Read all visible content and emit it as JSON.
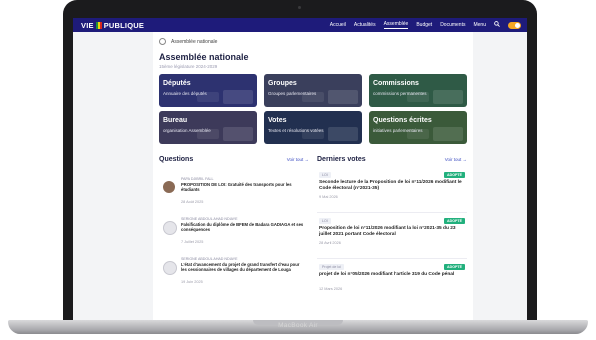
{
  "nav": {
    "logo_left": "VIE",
    "logo_right": "PUBLIQUE",
    "flag_colors": [
      "#1f8f3a",
      "#f2d10a",
      "#d7261e"
    ],
    "links": [
      "Accueil",
      "Actualités",
      "Assemblée",
      "Budget",
      "Documents",
      "Menu"
    ],
    "active": "Assemblée",
    "search_icon": "search-icon",
    "theme_toggle_color": "#f5a623"
  },
  "breadcrumb": {
    "current": "Assemblée nationale"
  },
  "page": {
    "title": "Assemblée nationale",
    "subtitle": "15ème législature 2024-2029"
  },
  "tiles": [
    {
      "title": "Députés",
      "desc": "Annuaire des députés",
      "color": "#2d3270"
    },
    {
      "title": "Groupes",
      "desc": "Groupes parlementaires",
      "color": "#3a3f5c"
    },
    {
      "title": "Commissions",
      "desc": "commissions permanentes",
      "color": "#2f5a46"
    },
    {
      "title": "Bureau",
      "desc": "organisation Assemblée",
      "color": "#3d3a5a"
    },
    {
      "title": "Votes",
      "desc": "Textes et résolutions votées",
      "color": "#223050"
    },
    {
      "title": "Questions écrites",
      "desc": "initiatives parlementaires",
      "color": "#3b5a3a"
    }
  ],
  "questions": {
    "title": "Questions",
    "see_all": "Voir tout →",
    "items": [
      {
        "author": "PAPA DJIBRIL FALL",
        "title": "PROPOSITION DE LOI: Gratuité des transports pour les étudiants",
        "date": "28 Août 2025"
      },
      {
        "author": "SERIGNE ABDOUL AHAD NDIAYE",
        "title": "Falsification du diplôme de BFEM de Badara GADIAGA et ses conséquences",
        "date": "7 Juillet 2025"
      },
      {
        "author": "SERIGNE ABDOUL AHAD NDIAYE",
        "title": "L'état d'avancement du projet de grand transfert d'eau pour les cessionnaires de villages du département de Louga",
        "date": "19 Juin 2025"
      }
    ]
  },
  "votes": {
    "title": "Derniers votes",
    "see_all": "Voir tout →",
    "badge_color": "#22b07d",
    "items": [
      {
        "tag": "LOI",
        "badge": "ADOPTÉ",
        "title": "Seconde lecture de la Proposition de loi n°11/2026 modifiant le Code électoral (n°2021-35)",
        "date": "9 Mai 2026"
      },
      {
        "tag": "LOI",
        "badge": "ADOPTÉ",
        "title": "Proposition de loi n°11/2026 modifiant la loi n°2021-35 du 23 juillet 2021 portant Code électoral",
        "date": "28 Avril 2026"
      },
      {
        "tag": "Projet de loi",
        "badge": "ADOPTÉ",
        "title": "projet de loi n°05/2026 modifiant l'article 319 du Code pénal",
        "date": "12 Mars 2026"
      }
    ]
  },
  "device": {
    "label": "MacBook Air"
  }
}
